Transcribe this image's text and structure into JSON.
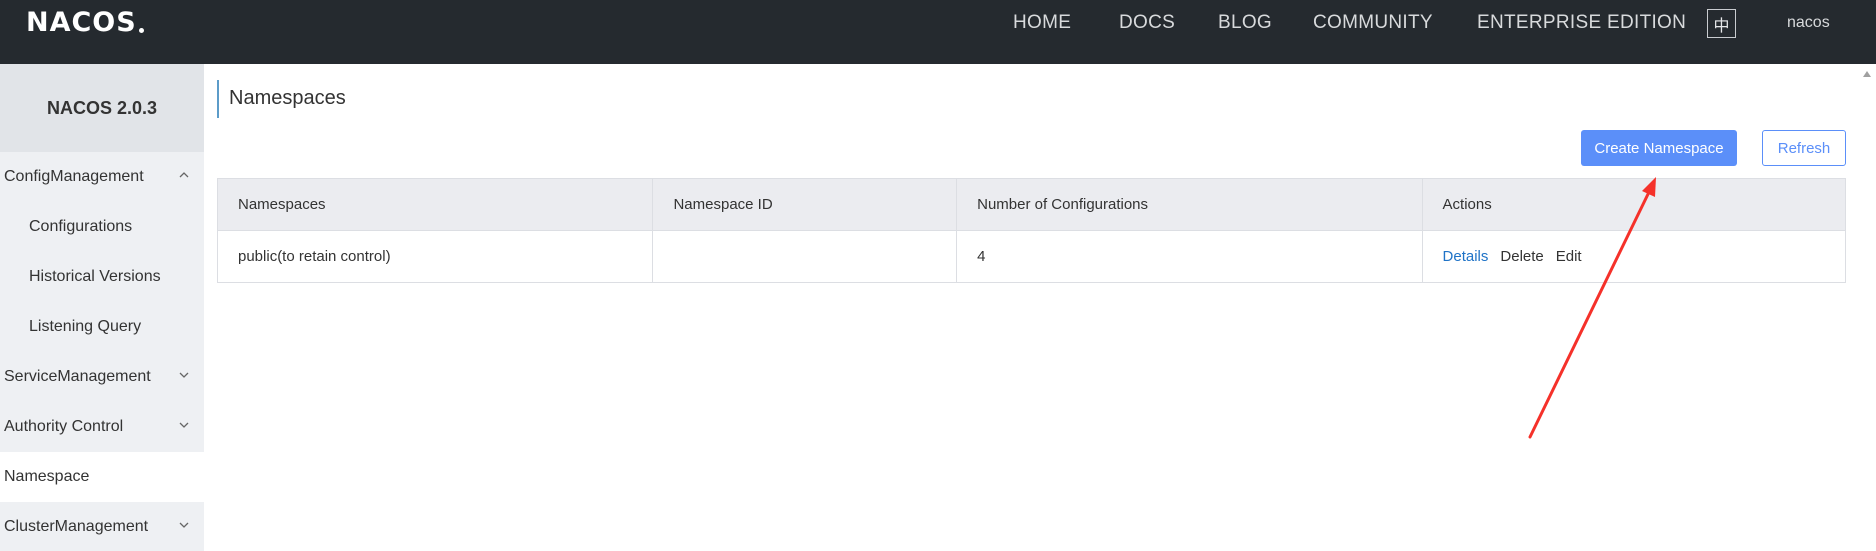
{
  "navbar": {
    "logo_text": "NACOS",
    "items": [
      {
        "label": "HOME"
      },
      {
        "label": "DOCS"
      },
      {
        "label": "BLOG"
      },
      {
        "label": "COMMUNITY"
      },
      {
        "label": "ENTERPRISE EDITION"
      }
    ],
    "lang_button": "中",
    "user": "nacos"
  },
  "sidebar": {
    "version": "NACOS 2.0.3",
    "items": [
      {
        "label": "ConfigManagement",
        "icon": "chevron-up-icon"
      },
      {
        "label": "Configurations"
      },
      {
        "label": "Historical Versions"
      },
      {
        "label": "Listening Query"
      },
      {
        "label": "ServiceManagement",
        "icon": "chevron-down-icon"
      },
      {
        "label": "Authority Control",
        "icon": "chevron-down-icon"
      },
      {
        "label": "Namespace",
        "active": true
      },
      {
        "label": "ClusterManagement",
        "icon": "chevron-down-icon"
      }
    ]
  },
  "main": {
    "title": "Namespaces",
    "create_button": "Create Namespace",
    "refresh_button": "Refresh",
    "table": {
      "columns": [
        "Namespaces",
        "Namespace ID",
        "Number of Configurations",
        "Actions"
      ],
      "rows": [
        {
          "namespace": "public(to retain control)",
          "namespace_id": "",
          "config_count": "4",
          "actions": [
            "Details",
            "Delete",
            "Edit"
          ]
        }
      ]
    }
  },
  "colors": {
    "navbar_bg": "#252a2f",
    "sidebar_bg": "#eef0f3",
    "primary": "#5b8ff9",
    "link": "#1f73c7",
    "annotation_arrow": "#f5312a"
  }
}
